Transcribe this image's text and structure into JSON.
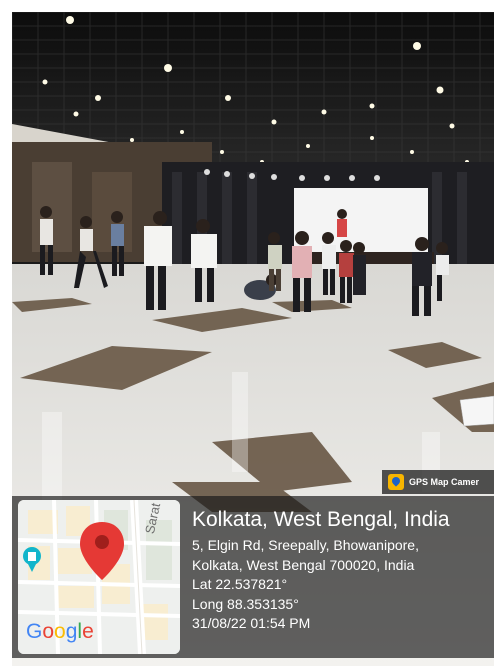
{
  "overlay": {
    "app_badge": "GPS Map Camer",
    "app_badge_icon": "gps-map-camera-icon",
    "location_title": "Kolkata, West Bengal, India",
    "address_line1": "5, Elgin Rd, Sreepally, Bhowanipore,",
    "address_line2": "Kolkata, West Bengal 700020, India",
    "latitude": "Lat 22.537821°",
    "longitude": "Long 88.353135°",
    "datetime": "31/08/22 01:54 PM"
  },
  "map": {
    "road_label": "Sarat Bose Rd",
    "logo_letters": [
      "G",
      "o",
      "o",
      "g",
      "l",
      "e"
    ],
    "logo_colors": [
      "#4285F4",
      "#EA4335",
      "#FBBC05",
      "#4285F4",
      "#34A853",
      "#EA4335"
    ],
    "pin_color": "#e53935",
    "poi_color": "#12b5cb",
    "icons": [
      "map-pin-icon",
      "landmark-icon"
    ]
  },
  "photo": {
    "subject": "dance rehearsal in a banquet hall",
    "colors": {
      "ceiling": "#141414",
      "floor_light": "#eceae6",
      "floor_dark": "#6b5a48",
      "screen": "#f4f4f4"
    }
  }
}
